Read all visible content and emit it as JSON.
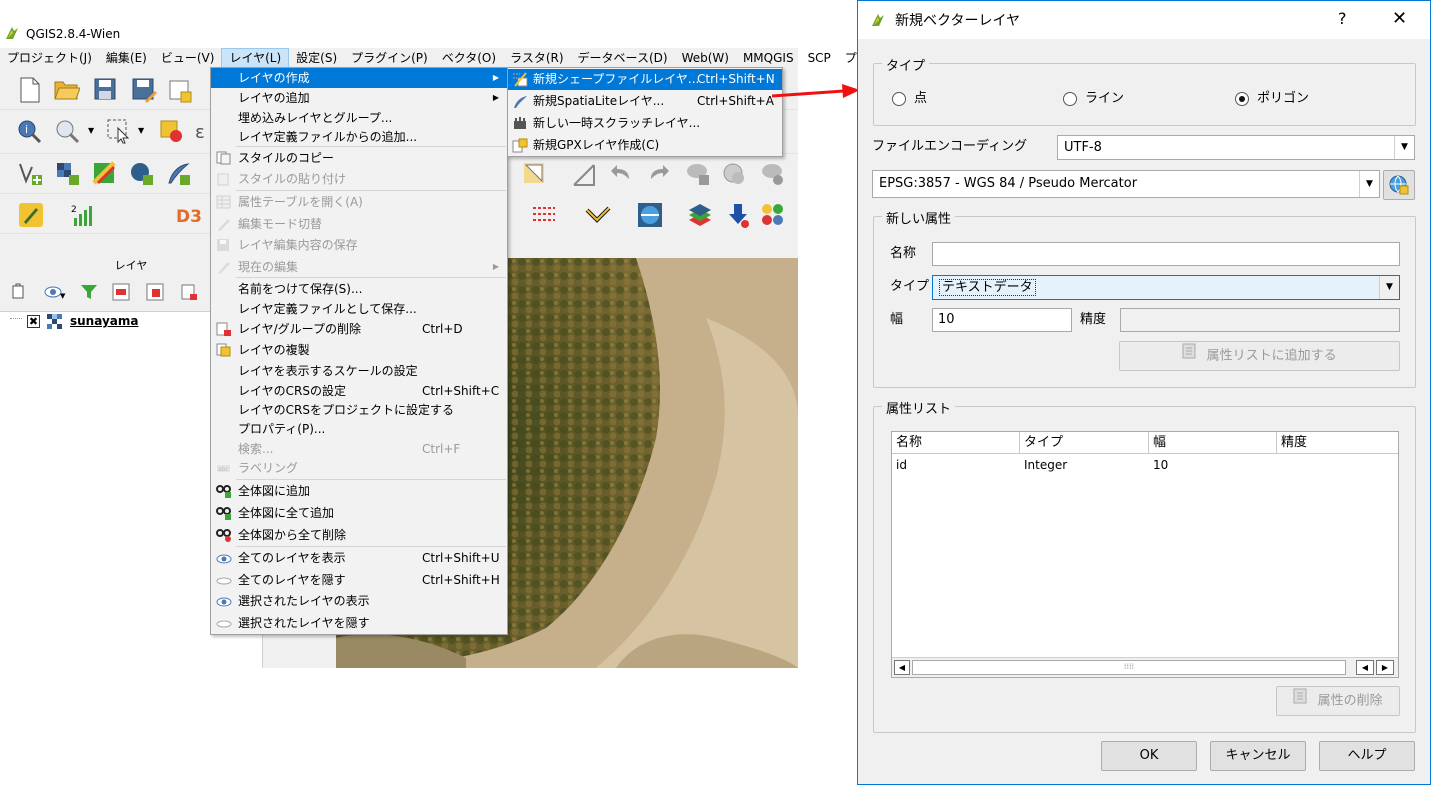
{
  "qgis": {
    "title": "QGIS2.8.4-Wien",
    "menus": [
      "プロジェクト(J)",
      "編集(E)",
      "ビュー(V)",
      "レイヤ(L)",
      "設定(S)",
      "プラグイン(P)",
      "ベクタ(O)",
      "ラスタ(R)",
      "データベース(D)",
      "Web(W)",
      "MMQGIS",
      "SCP",
      "プ"
    ],
    "active_menu_index": 3,
    "layers_panel": {
      "title": "レイヤ",
      "layer_name": "sunayama"
    }
  },
  "layer_menu": {
    "items": [
      {
        "label": "レイヤの作成",
        "shortcut": "",
        "submenu": true,
        "highlight": true,
        "disabled": false,
        "icon": ""
      },
      {
        "label": "レイヤの追加",
        "shortcut": "",
        "submenu": true,
        "highlight": false,
        "disabled": false,
        "icon": ""
      },
      {
        "label": "埋め込みレイヤとグループ...",
        "shortcut": "",
        "submenu": false,
        "highlight": false,
        "disabled": false,
        "icon": ""
      },
      {
        "label": "レイヤ定義ファイルからの追加...",
        "shortcut": "",
        "submenu": false,
        "highlight": false,
        "disabled": false,
        "icon": ""
      },
      {
        "label": "スタイルのコピー",
        "shortcut": "",
        "submenu": false,
        "highlight": false,
        "disabled": false,
        "icon": "copy-style-icon"
      },
      {
        "label": "スタイルの貼り付け",
        "shortcut": "",
        "submenu": false,
        "highlight": false,
        "disabled": true,
        "icon": "paste-style-icon"
      },
      {
        "label": "属性テーブルを開く(A)",
        "shortcut": "",
        "submenu": false,
        "highlight": false,
        "disabled": true,
        "icon": "attribute-table-icon"
      },
      {
        "label": "編集モード切替",
        "shortcut": "",
        "submenu": false,
        "highlight": false,
        "disabled": true,
        "icon": "toggle-edit-icon"
      },
      {
        "label": "レイヤ編集内容の保存",
        "shortcut": "",
        "submenu": false,
        "highlight": false,
        "disabled": true,
        "icon": "save-edits-icon"
      },
      {
        "label": "現在の編集",
        "shortcut": "",
        "submenu": true,
        "highlight": false,
        "disabled": true,
        "icon": "current-edits-icon"
      },
      {
        "label": "名前をつけて保存(S)...",
        "shortcut": "",
        "submenu": false,
        "highlight": false,
        "disabled": false,
        "icon": ""
      },
      {
        "label": "レイヤ定義ファイルとして保存...",
        "shortcut": "",
        "submenu": false,
        "highlight": false,
        "disabled": false,
        "icon": ""
      },
      {
        "label": "レイヤ/グループの削除",
        "shortcut": "Ctrl+D",
        "submenu": false,
        "highlight": false,
        "disabled": false,
        "icon": "remove-layer-icon"
      },
      {
        "label": "レイヤの複製",
        "shortcut": "",
        "submenu": false,
        "highlight": false,
        "disabled": false,
        "icon": "duplicate-layer-icon"
      },
      {
        "label": "レイヤを表示するスケールの設定",
        "shortcut": "",
        "submenu": false,
        "highlight": false,
        "disabled": false,
        "icon": ""
      },
      {
        "label": "レイヤのCRSの設定",
        "shortcut": "Ctrl+Shift+C",
        "submenu": false,
        "highlight": false,
        "disabled": false,
        "icon": ""
      },
      {
        "label": "レイヤのCRSをプロジェクトに設定する",
        "shortcut": "",
        "submenu": false,
        "highlight": false,
        "disabled": false,
        "icon": ""
      },
      {
        "label": "プロパティ(P)...",
        "shortcut": "",
        "submenu": false,
        "highlight": false,
        "disabled": false,
        "icon": ""
      },
      {
        "label": "検索...",
        "shortcut": "Ctrl+F",
        "submenu": false,
        "highlight": false,
        "disabled": true,
        "icon": ""
      },
      {
        "label": "ラベリング",
        "shortcut": "",
        "submenu": false,
        "highlight": false,
        "disabled": true,
        "icon": "labeling-icon"
      },
      {
        "label": "全体図に追加",
        "shortcut": "",
        "submenu": false,
        "highlight": false,
        "disabled": false,
        "icon": "overview-add-icon"
      },
      {
        "label": "全体図に全て追加",
        "shortcut": "",
        "submenu": false,
        "highlight": false,
        "disabled": false,
        "icon": "overview-add-all-icon"
      },
      {
        "label": "全体図から全て削除",
        "shortcut": "",
        "submenu": false,
        "highlight": false,
        "disabled": false,
        "icon": "overview-remove-all-icon"
      },
      {
        "label": "全てのレイヤを表示",
        "shortcut": "Ctrl+Shift+U",
        "submenu": false,
        "highlight": false,
        "disabled": false,
        "icon": "eye-icon"
      },
      {
        "label": "全てのレイヤを隠す",
        "shortcut": "Ctrl+Shift+H",
        "submenu": false,
        "highlight": false,
        "disabled": false,
        "icon": "eye-closed-icon"
      },
      {
        "label": "選択されたレイヤの表示",
        "shortcut": "",
        "submenu": false,
        "highlight": false,
        "disabled": false,
        "icon": "eye-icon"
      },
      {
        "label": "選択されたレイヤを隠す",
        "shortcut": "",
        "submenu": false,
        "highlight": false,
        "disabled": false,
        "icon": "eye-closed-icon"
      }
    ]
  },
  "sub_menu": {
    "items": [
      {
        "label": "新規シェープファイルレイヤ...",
        "shortcut": "Ctrl+Shift+N",
        "highlight": true,
        "icon": "new-shapefile-icon"
      },
      {
        "label": "新規SpatiaLiteレイヤ...",
        "shortcut": "Ctrl+Shift+A",
        "highlight": false,
        "icon": "new-spatialite-icon"
      },
      {
        "label": "新しい一時スクラッチレイヤ...",
        "shortcut": "",
        "highlight": false,
        "icon": "new-scratch-icon"
      },
      {
        "label": "新規GPXレイヤ作成(C)",
        "shortcut": "",
        "highlight": false,
        "icon": "new-gpx-icon"
      }
    ]
  },
  "dialog": {
    "title": "新規ベクターレイヤ",
    "help_label": "?",
    "close_label": "✕",
    "type_group": {
      "title": "タイプ",
      "options": [
        {
          "label": "点",
          "checked": false
        },
        {
          "label": "ライン",
          "checked": false
        },
        {
          "label": "ポリゴン",
          "checked": true
        }
      ]
    },
    "encoding_label": "ファイルエンコーディング",
    "encoding_value": "UTF-8",
    "crs_value": "EPSG:3857 - WGS 84 / Pseudo Mercator",
    "new_attr": {
      "title": "新しい属性",
      "name_label": "名称",
      "name_value": "",
      "type_label": "タイプ",
      "type_value": "テキストデータ",
      "width_label": "幅",
      "width_value": "10",
      "precision_label": "精度",
      "precision_value": "",
      "add_button": "属性リストに追加する"
    },
    "attr_list": {
      "title": "属性リスト",
      "columns": [
        "名称",
        "タイプ",
        "幅",
        "精度"
      ],
      "rows": [
        [
          "id",
          "Integer",
          "10",
          ""
        ]
      ]
    },
    "remove_button": "属性の削除",
    "ok_button": "OK",
    "cancel_button": "キャンセル",
    "help_button": "ヘルプ"
  },
  "colors": {
    "highlight": "#0078d7",
    "arrow": "#ee1111"
  }
}
